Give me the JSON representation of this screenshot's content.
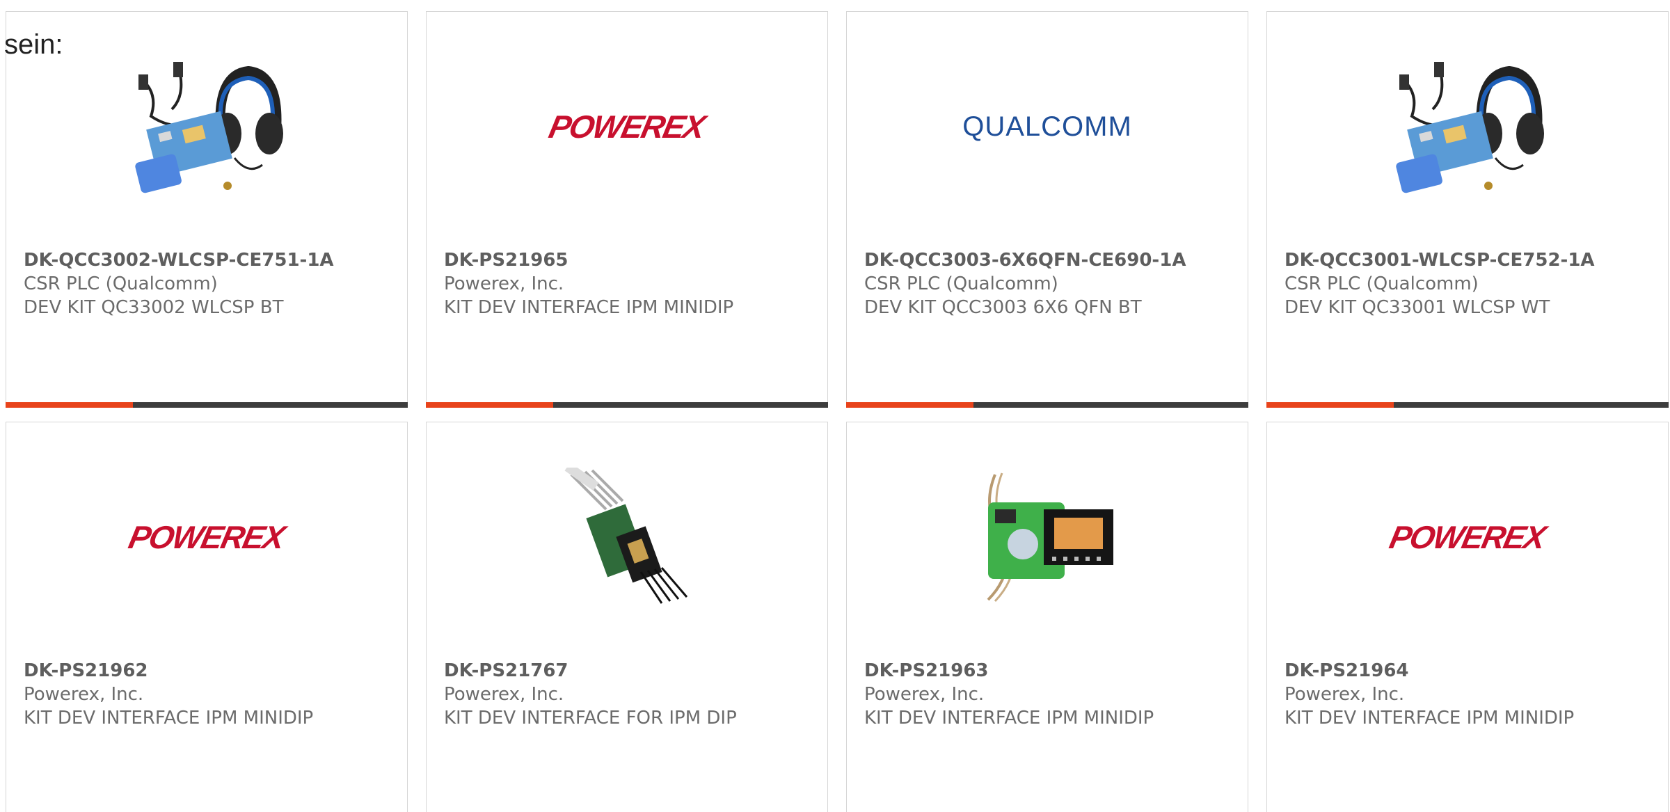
{
  "intro_text": "sein:",
  "colors": {
    "accent": "#e8431b",
    "bar": "#3d3d3d",
    "powerex_red": "#c8102e",
    "qualcomm_blue": "#1f4f99"
  },
  "products": [
    {
      "part": "DK-QCC3002-WLCSP-CE751-1A",
      "manufacturer": "CSR PLC (Qualcomm)",
      "description": "DEV KIT QC33002 WLCSP BT",
      "image": "headset-kit-photo"
    },
    {
      "part": "DK-PS21965",
      "manufacturer": "Powerex, Inc.",
      "description": "KIT DEV INTERFACE IPM MINIDIP",
      "image": "powerex-logo",
      "logo_text": "POWEREX"
    },
    {
      "part": "DK-QCC3003-6X6QFN-CE690-1A",
      "manufacturer": "CSR PLC (Qualcomm)",
      "description": "DEV KIT QCC3003 6X6 QFN BT",
      "image": "qualcomm-logo",
      "logo_text": "QUALCOMM"
    },
    {
      "part": "DK-QCC3001-WLCSP-CE752-1A",
      "manufacturer": "CSR PLC (Qualcomm)",
      "description": "DEV KIT QC33001 WLCSP WT",
      "image": "headset-kit-photo"
    },
    {
      "part": "DK-PS21962",
      "manufacturer": "Powerex, Inc.",
      "description": "KIT DEV INTERFACE IPM MINIDIP",
      "image": "powerex-logo",
      "logo_text": "POWEREX"
    },
    {
      "part": "DK-PS21767",
      "manufacturer": "Powerex, Inc.",
      "description": "KIT DEV INTERFACE FOR IPM DIP",
      "image": "cable-board-photo"
    },
    {
      "part": "DK-PS21963",
      "manufacturer": "Powerex, Inc.",
      "description": "KIT DEV INTERFACE IPM MINIDIP",
      "image": "green-board-photo"
    },
    {
      "part": "DK-PS21964",
      "manufacturer": "Powerex, Inc.",
      "description": "KIT DEV INTERFACE IPM MINIDIP",
      "image": "powerex-logo",
      "logo_text": "POWEREX"
    }
  ]
}
